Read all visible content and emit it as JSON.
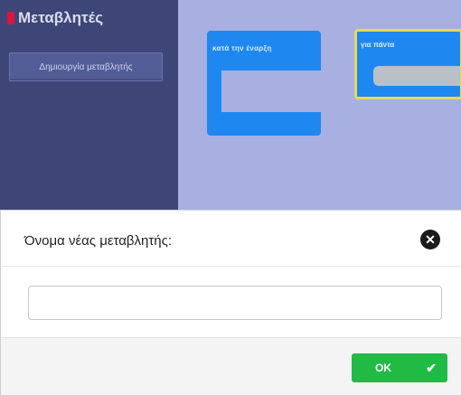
{
  "flyout": {
    "category_title": "Μεταβλητές",
    "create_variable_label": "Δημιουργία μεταβλητής"
  },
  "workspace": {
    "block_on_start_label": "κατά την έναρξη",
    "block_forever_label": "για πάντα"
  },
  "dialog": {
    "title": "Όνομα νέας μεταβλητής:",
    "close_icon": "close-icon",
    "input_value": "",
    "input_placeholder": "",
    "ok_label": "OK",
    "ok_icon": "checkmark-icon"
  },
  "colors": {
    "category_accent": "#dc143c",
    "block_blue": "#1e88f0",
    "ok_green": "#21ba45",
    "flyout_bg": "#3e4677",
    "workspace_bg": "#a7b0e0"
  }
}
